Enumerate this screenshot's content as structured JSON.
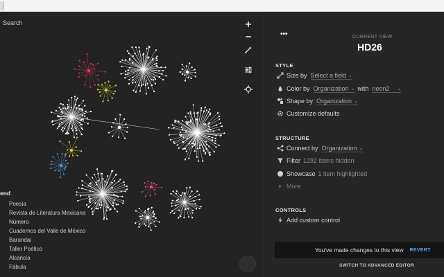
{
  "graph": {
    "search_label": "Search",
    "legend": {
      "title": "end",
      "items": [
        "Poesía",
        "Revista de Literatura Mexicana",
        "Número",
        "Cuadernos del Valle de México",
        "Barandal",
        "Taller Poético",
        "Alcancía",
        "Fábula"
      ]
    },
    "toolbar_icons": [
      "zoom-in-icon",
      "zoom-out-icon",
      "pen-icon",
      "sliders-icon",
      "move-icon"
    ],
    "colors": {
      "background": "#232323",
      "node": "#ffffff",
      "red_cluster": "#d23a4c",
      "yellow_cluster": "#d6d23a",
      "blue_cluster": "#4a9ad6",
      "pink_cluster": "#e04a8a"
    }
  },
  "panel": {
    "more_label": "•••",
    "current_view_label": "CURRENT VIEW",
    "current_view_name": "HD26",
    "style": {
      "title": "STYLE",
      "size_by": {
        "label": "Size by",
        "value": "Select a field"
      },
      "color_by": {
        "label": "Color by",
        "value": "Organization",
        "with_label": "with",
        "palette": "neon2"
      },
      "shape_by": {
        "label": "Shape by",
        "value": "Organization"
      },
      "customize_label": "Customize defaults"
    },
    "structure": {
      "title": "STRUCTURE",
      "connect_by": {
        "label": "Connect by",
        "value": "Organization"
      },
      "filter": {
        "label": "Filter",
        "detail": "1292 items hidden"
      },
      "showcase": {
        "label": "Showcase",
        "detail": "1 item highlighted"
      },
      "more_label": "More"
    },
    "controls": {
      "title": "CONTROLS",
      "add_label": "Add custom control"
    },
    "toast": {
      "message": "You've made changes to this view",
      "revert_label": "REVERT"
    },
    "advanced_editor_label": "SWITCH TO ADVANCED EDITOR",
    "accent_color": "#5aa0e6"
  }
}
